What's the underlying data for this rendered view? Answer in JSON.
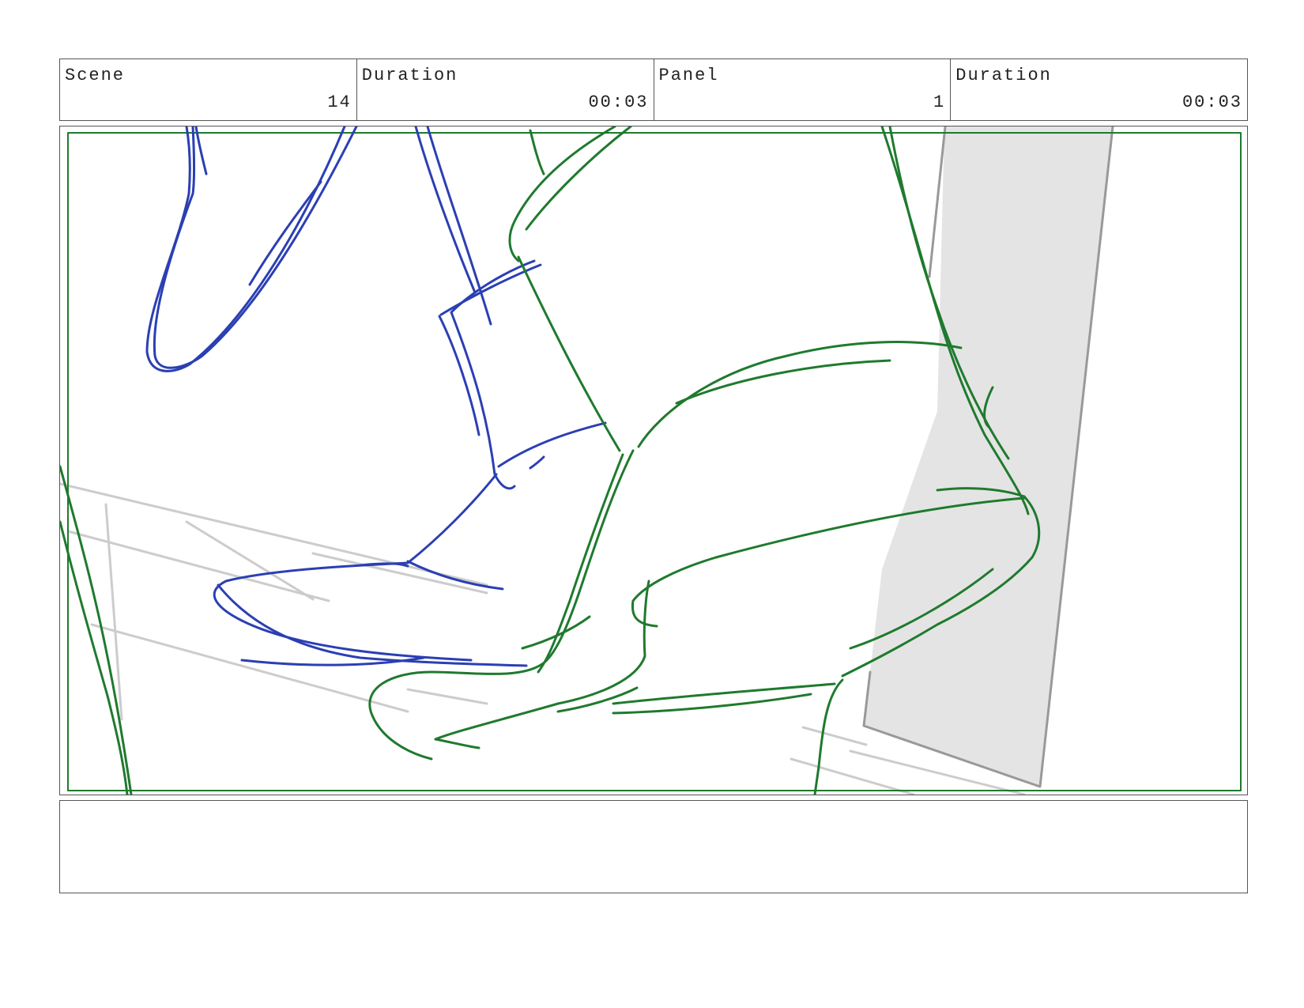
{
  "header": {
    "scene_label": "Scene",
    "scene_value": "14",
    "duration_label": "Duration",
    "duration_value": "00:03",
    "panel_label": "Panel",
    "panel_value": "1",
    "panel_duration_label": "Duration",
    "panel_duration_value": "00:03"
  },
  "colors": {
    "blue_line": "#2b3fb3",
    "green_line": "#1f7a2e",
    "gray_line": "#cccccc",
    "wall_fill": "#e4e4e4",
    "wall_edge": "#999999",
    "safe_frame": "#1f7a2e"
  },
  "notes": {
    "text": ""
  }
}
